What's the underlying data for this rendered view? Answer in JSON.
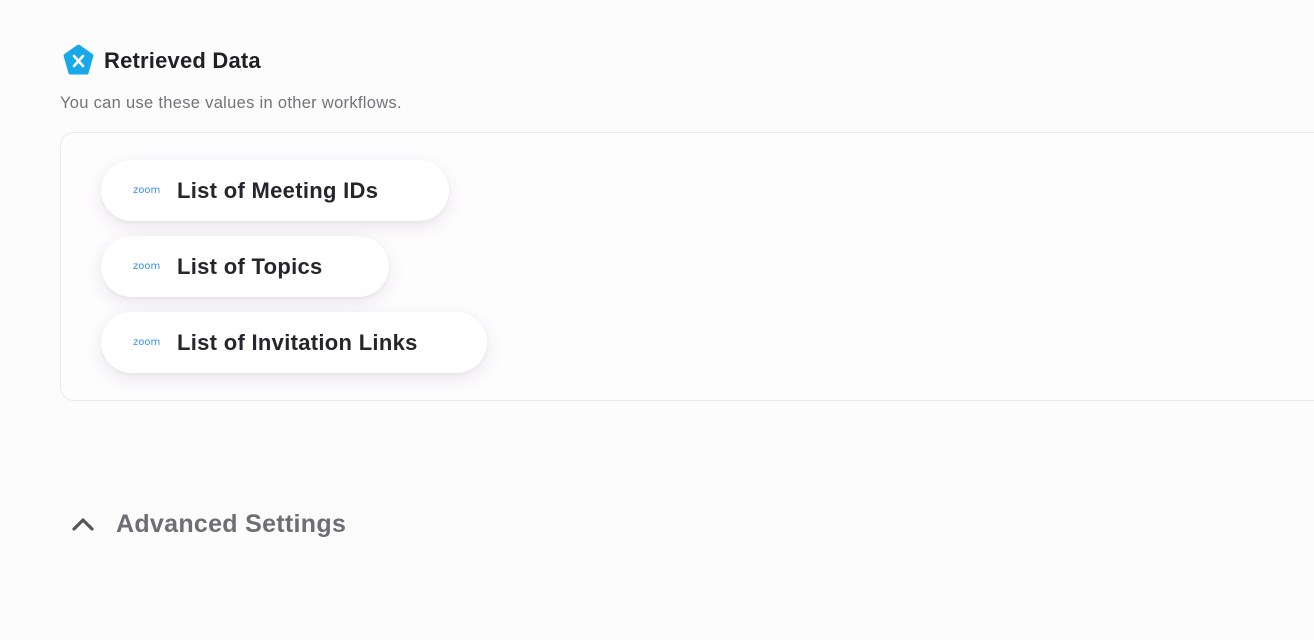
{
  "header": {
    "title": "Retrieved Data",
    "subtitle": "You can use these values in other workflows.",
    "icon": "brand-x-icon",
    "icon_color": "#19a8e8"
  },
  "retrieved_items": [
    {
      "icon": "zoom-icon",
      "icon_text": "zoom",
      "label": "List of Meeting IDs"
    },
    {
      "icon": "zoom-icon",
      "icon_text": "zoom",
      "label": "List of Topics"
    },
    {
      "icon": "zoom-icon",
      "icon_text": "zoom",
      "label": "List of Invitation Links"
    }
  ],
  "advanced_settings": {
    "label": "Advanced Settings",
    "icon": "chevron-up-icon",
    "expanded": true
  },
  "colors": {
    "zoom_blue": "#2d8cff",
    "title_text": "#1f1f24",
    "muted_text": "#74727a"
  }
}
